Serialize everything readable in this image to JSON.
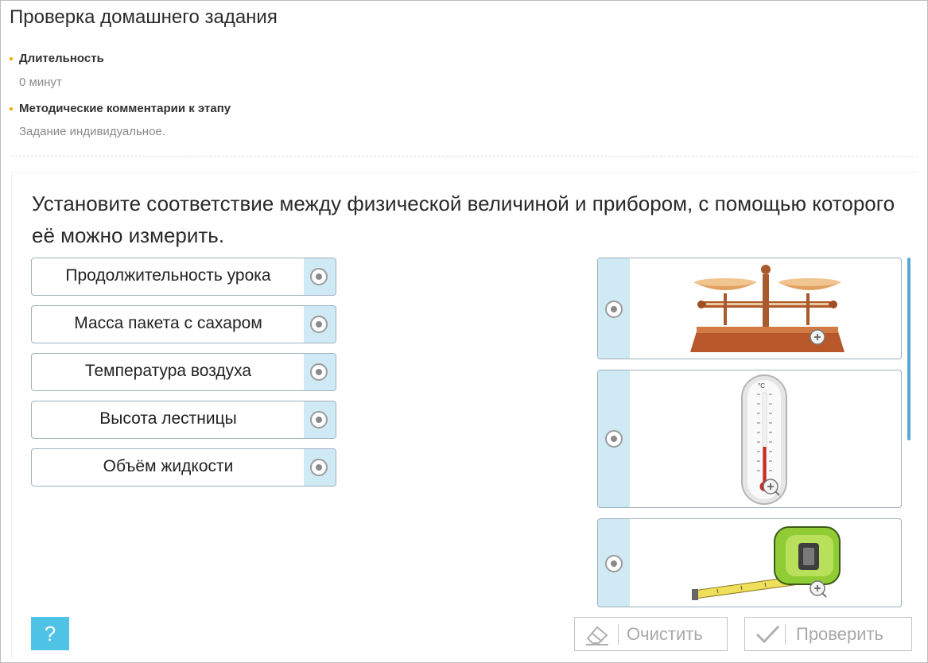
{
  "stage": {
    "title": "Проверка домашнего задания",
    "duration_label": "Длительность",
    "duration_value": "0 минут",
    "comments_label": "Методические комментарии к этапу",
    "comments_value": "Задание индивидуальное."
  },
  "task": {
    "question": "Установите соответствие между физической величиной и прибором, с помощью которого её можно измерить.",
    "left_items": [
      {
        "label": "Продолжительность урока"
      },
      {
        "label": "Масса пакета с сахаром"
      },
      {
        "label": "Температура воздуха"
      },
      {
        "label": "Высота лестницы"
      },
      {
        "label": "Объём жидкости"
      }
    ],
    "right_items": [
      {
        "icon": "scales-image"
      },
      {
        "icon": "thermometer-image"
      },
      {
        "icon": "tape-measure-image"
      }
    ],
    "thermometer_unit": "°C"
  },
  "controls": {
    "help_label": "?",
    "clear_label": "Очистить",
    "check_label": "Проверить"
  },
  "colors": {
    "handle": "#cfe9f5",
    "border": "#9fb1c0",
    "help": "#4fc3e6",
    "accent_dot": "#f0a500",
    "scroll": "#5aa7d6"
  }
}
